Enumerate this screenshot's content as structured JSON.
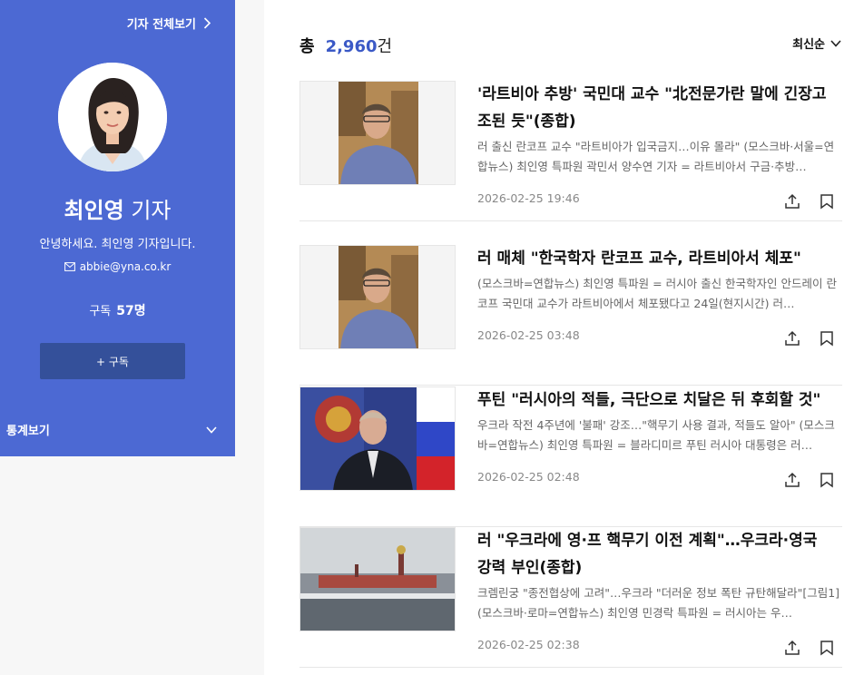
{
  "profile": {
    "view_all": "기자 전체보기",
    "name_bold": "최인영",
    "name_suffix": " 기자",
    "greeting": "안녕하세요. 최인영 기자입니다.",
    "email": "abbie@yna.co.kr",
    "subscribers_label": "구독",
    "subscribers_count": "57명",
    "subscribe_button": "+ 구독",
    "stats_label": "통계보기"
  },
  "list": {
    "total_label": "총",
    "total_count": "2,960",
    "total_unit": "건",
    "sort_label": "최신순"
  },
  "articles": [
    {
      "title": "'라트비아 추방' 국민대 교수 \"北전문가란 말에 긴장고조된 듯\"(종합)",
      "summary": "러 출신 란코프 교수 \"라트비아가 입국금지…이유 몰라\" (모스크바·서울=연합뉴스) 최인영 특파원 곽민서 양수연 기자 = 라트비아서 구금·추방…",
      "date": "2026-02-25 19:46"
    },
    {
      "title": "러 매체 \"한국학자 란코프 교수, 라트비아서 체포\"",
      "summary": "(모스크바=연합뉴스) 최인영 특파원 = 러시아 출신 한국학자인 안드레이 란코프 국민대 교수가 라트비아에서 체포됐다고 24일(현지시간) 러…",
      "date": "2026-02-25 03:48"
    },
    {
      "title": "푸틴 \"러시아의 적들, 극단으로 치달은 뒤 후회할 것\"",
      "summary": "우크라 작전 4주년에 '불패' 강조…\"핵무기 사용 결과, 적들도 알아\" (모스크바=연합뉴스) 최인영 특파원 = 블라디미르 푸틴 러시아 대통령은 러…",
      "date": "2026-02-25 02:48"
    },
    {
      "title": "러 \"우크라에 영·프 핵무기 이전 계획\"…우크라·영국 강력 부인(종합)",
      "summary": "크렘린궁 \"종전협상에 고려\"…우크라 \"더러운 정보 폭탄 규탄해달라\"[그림1] (모스크바·로마=연합뉴스) 최인영 민경락 특파원 = 러시아는 우…",
      "date": "2026-02-25 02:38"
    }
  ],
  "icons": {
    "share": "share-icon",
    "bookmark": "bookmark-icon",
    "mail": "mail-icon"
  },
  "colors": {
    "profile_bg": "#4c69d3",
    "subscribe_bg": "#34509a",
    "count_accent": "#3b59c6"
  }
}
